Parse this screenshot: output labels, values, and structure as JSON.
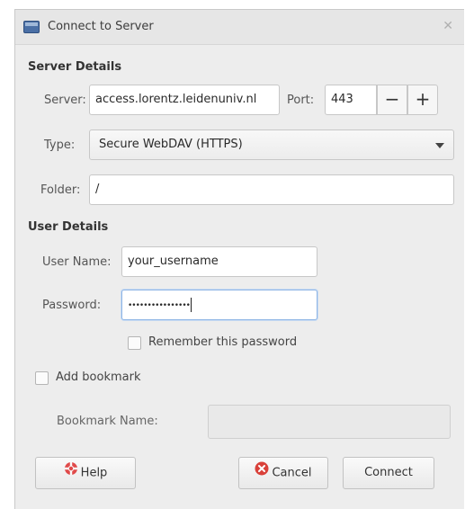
{
  "window": {
    "title": "Connect to Server",
    "icon": "network-drive-icon"
  },
  "server_details": {
    "heading": "Server Details",
    "server_label": "Server:",
    "server_value": "access.lorentz.leidenuniv.nl",
    "port_label": "Port:",
    "port_value": "443",
    "decrement_label": "−",
    "increment_label": "+",
    "type_label": "Type:",
    "type_value": "Secure WebDAV (HTTPS)",
    "folder_label": "Folder:",
    "folder_value": "/"
  },
  "user_details": {
    "heading": "User Details",
    "username_label": "User Name:",
    "username_value": "your_username",
    "password_label": "Password:",
    "password_value": "••••••••••••••••",
    "remember_label": "Remember this password"
  },
  "bookmark": {
    "add_label": "Add bookmark",
    "name_label": "Bookmark Name:",
    "name_value": ""
  },
  "buttons": {
    "help": "Help",
    "cancel": "Cancel",
    "connect": "Connect"
  },
  "colors": {
    "help_icon": "#e04a4a",
    "cancel_icon": "#d9413a",
    "focus_ring": "#8fb5e5"
  }
}
